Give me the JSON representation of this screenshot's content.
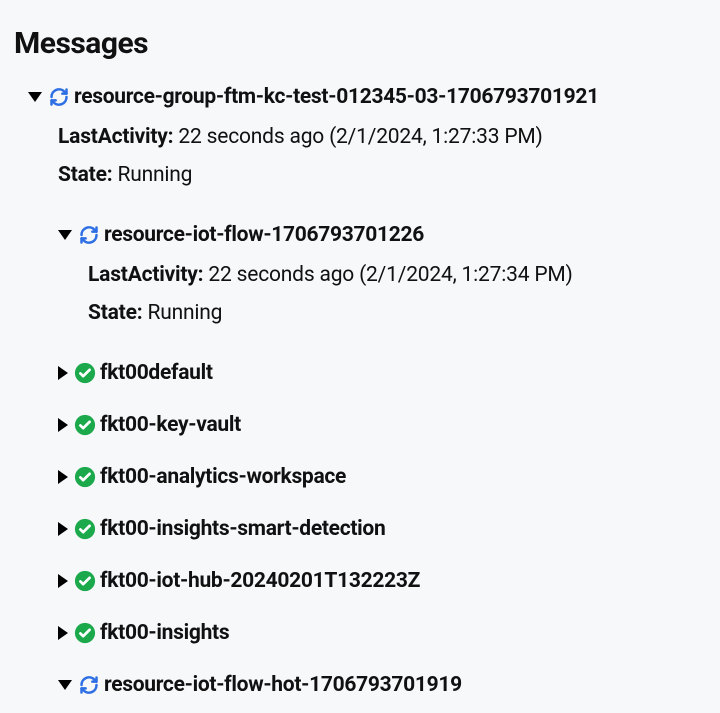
{
  "title": "Messages",
  "labels": {
    "lastActivity": "LastActivity:",
    "state": "State:"
  },
  "root": {
    "name": "resource-group-ftm-kc-test-012345-03-1706793701921",
    "lastActivity": "22 seconds ago (2/1/2024, 1:27:33 PM)",
    "state": "Running"
  },
  "nested": {
    "name": "resource-iot-flow-1706793701226",
    "lastActivity": "22 seconds ago (2/1/2024, 1:27:34 PM)",
    "state": "Running"
  },
  "items": [
    {
      "name": "fkt00default"
    },
    {
      "name": "fkt00-key-vault"
    },
    {
      "name": "fkt00-analytics-workspace"
    },
    {
      "name": "fkt00-insights-smart-detection"
    },
    {
      "name": "fkt00-iot-hub-20240201T132223Z"
    },
    {
      "name": "fkt00-insights"
    }
  ],
  "last": {
    "name": "resource-iot-flow-hot-1706793701919"
  }
}
